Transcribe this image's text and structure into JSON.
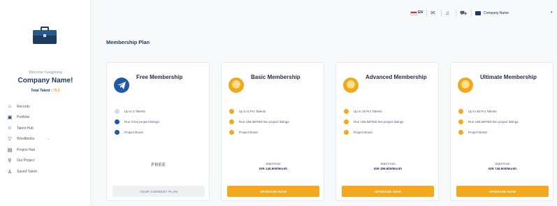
{
  "colors": {
    "accent": "#f2a91d",
    "brand": "#1e3a5f",
    "check_blue": "#1e5aa8"
  },
  "sidebar": {
    "welcome": "Welcome Surajpirang",
    "company": "Company Name!",
    "tokens_label": "Total Talent :",
    "tokens_value": "75.0",
    "items": [
      {
        "label": "Records",
        "icon": "home-icon"
      },
      {
        "label": "Portfolio",
        "icon": "briefcase-icon"
      },
      {
        "label": "Talent Hub",
        "icon": "users-icon"
      },
      {
        "label": "Wordbooks",
        "icon": "filter-icon",
        "chevron": "⌄"
      },
      {
        "label": "Project Hub",
        "icon": "document-icon"
      },
      {
        "label": "Our Project",
        "icon": "search-users-icon"
      },
      {
        "label": "Saved Talent",
        "icon": "saved-users-icon"
      }
    ]
  },
  "topbar": {
    "language": "EN",
    "company_name": "Company Name",
    "icons": [
      "flag-icon",
      "mail-icon",
      "bell-icon",
      "cart-icon",
      "business-icon"
    ]
  },
  "page_title": "Membership Plan",
  "plans": [
    {
      "name": "Free Membership",
      "icon": "telegram-icon",
      "features": [
        {
          "text": "Up to 2 Talents",
          "state": "disabled"
        },
        {
          "text": "Run 3 live project listings",
          "state": "check"
        },
        {
          "text": "Project Boost",
          "state": "check"
        }
      ],
      "price": "FREE",
      "button": "YOUR CURRENT PLAN"
    },
    {
      "name": "Basic Membership",
      "icon": "bronze-medal-icon",
      "features": [
        {
          "text": "Up to 5 Pro Talents"
        },
        {
          "text": "Run UNLIMITED live project listings"
        },
        {
          "text": "Project Boost"
        }
      ],
      "start_from": "Start From",
      "price": "IDR 149,900/Month",
      "button": "UPGRADE NOW"
    },
    {
      "name": "Advanced Membership",
      "icon": "silver-medal-icon",
      "features": [
        {
          "text": "Up to 15 Pro Talents"
        },
        {
          "text": "Run UNLIMITED live project listings"
        },
        {
          "text": "Project Boost"
        }
      ],
      "start_from": "Start From",
      "price": "IDR 399,900/Month",
      "button": "UPGRADE NOW"
    },
    {
      "name": "Ultimate Membership",
      "icon": "gold-medal-icon",
      "features": [
        {
          "text": "Up to 50 Pro Talents"
        },
        {
          "text": "Run UNLIMITED live project listings"
        },
        {
          "text": "Project Boost"
        }
      ],
      "start_from": "Start From",
      "price": "IDR 749,900/Month",
      "button": "UPGRADE NOW"
    }
  ]
}
